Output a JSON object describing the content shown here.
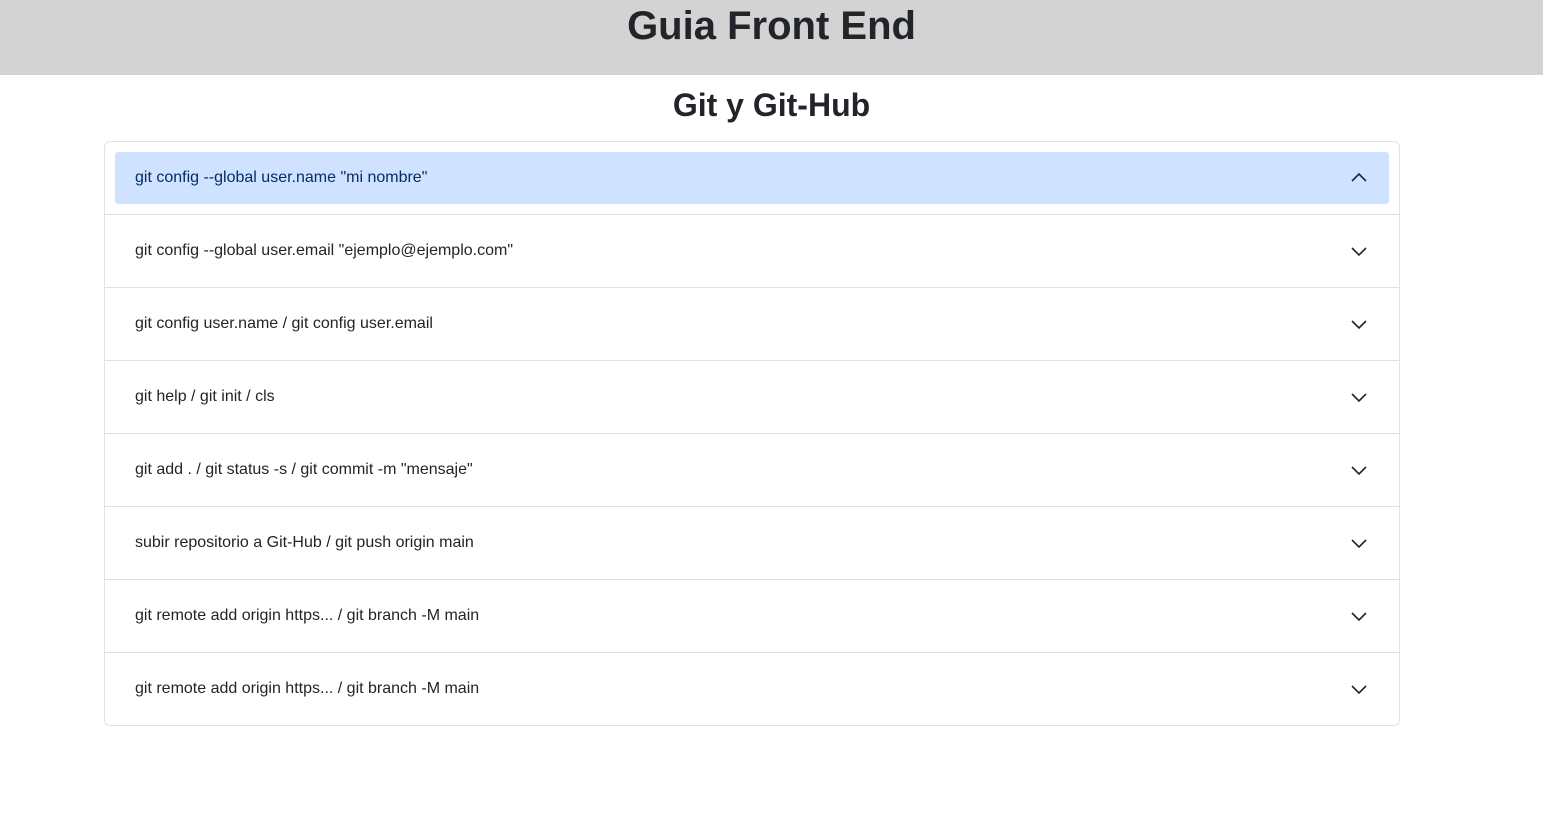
{
  "header": {
    "title": "Guia Front End"
  },
  "section": {
    "title": "Git y Git-Hub"
  },
  "accordion": {
    "items": [
      {
        "label": "git config --global user.name \"mi nombre\"",
        "expanded": true
      },
      {
        "label": "git config --global user.email \"ejemplo@ejemplo.com\"",
        "expanded": false
      },
      {
        "label": "git config user.name / git config user.email",
        "expanded": false
      },
      {
        "label": "git help / git init / cls",
        "expanded": false
      },
      {
        "label": "git add . / git status -s / git commit -m \"mensaje\"",
        "expanded": false
      },
      {
        "label": "subir repositorio a Git-Hub / git push origin main",
        "expanded": false
      },
      {
        "label": "git remote add origin https... / git branch -M main",
        "expanded": false
      },
      {
        "label": "git remote add origin https... / git branch -M main",
        "expanded": false
      }
    ],
    "icons": {
      "expanded": "chevron-up-icon",
      "collapsed": "chevron-down-icon"
    }
  },
  "colors": {
    "header_bg": "#d3d3d3",
    "active_item_bg": "#cfe2ff",
    "border": "#dee2e6"
  }
}
